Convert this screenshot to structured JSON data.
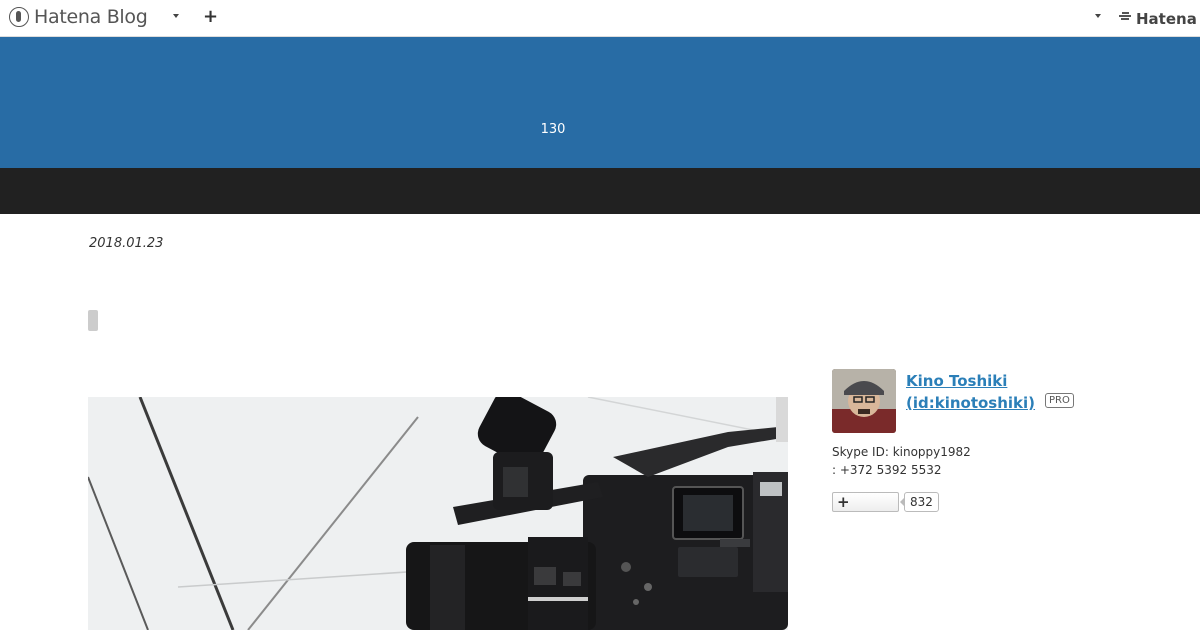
{
  "topbar": {
    "brand": "Hatena Blog",
    "company": "Hatena"
  },
  "header": {
    "text": "130"
  },
  "article": {
    "date": "2018.01.23"
  },
  "profile": {
    "name_line1": "Kino Toshiki",
    "name_line2": "(id:kinotoshiki)",
    "badge": "PRO",
    "skype": "Skype ID: kinoppy1982",
    "phone": ": +372 5392 5532",
    "subscriber_count": "832"
  },
  "colors": {
    "header_bg": "#286ca5",
    "nav_bg": "#212121",
    "link": "#2b7fb8"
  },
  "icons": [
    "hatena-blog-logo-icon",
    "caret-down-icon",
    "plus-icon",
    "hatena-logo-icon"
  ]
}
